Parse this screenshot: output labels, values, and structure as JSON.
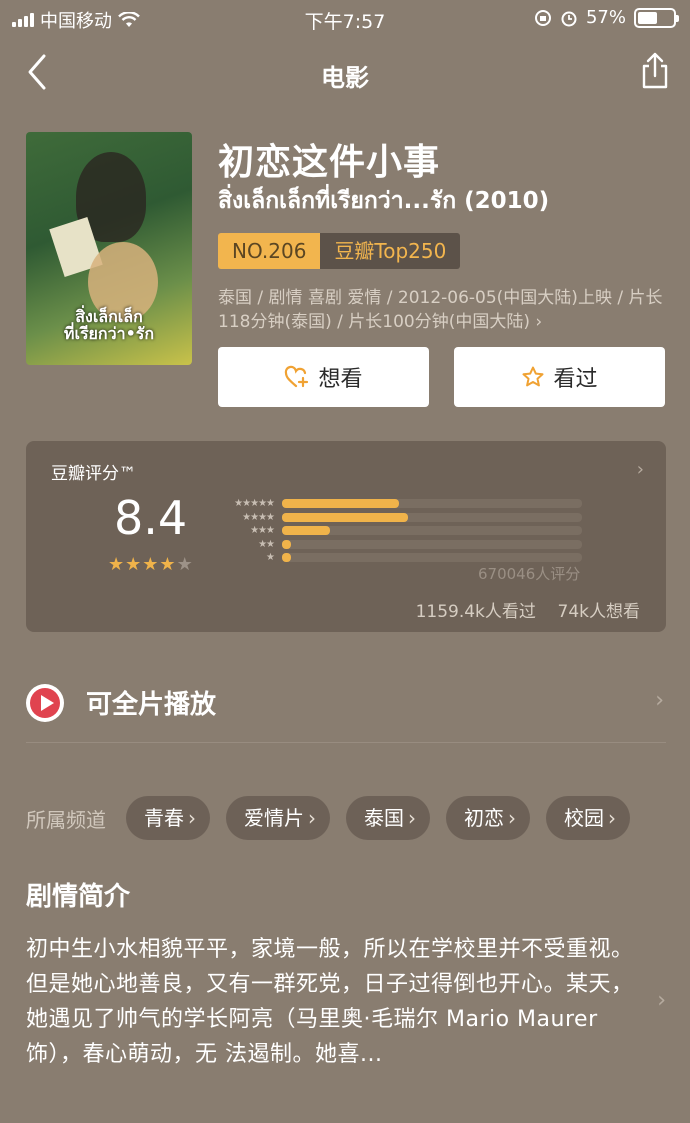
{
  "status_bar": {
    "carrier": "中国移动",
    "time": "下午7:57",
    "battery_percent": "57%",
    "battery_level": 0.57
  },
  "nav": {
    "title": "电影"
  },
  "movie": {
    "title_cn": "初恋这件小事",
    "title_original": "สิ่งเล็กเล็กที่เรียกว่า...รัก (2010)",
    "poster_text_line1": "สิ่งเล็กเล็ก",
    "poster_text_line2": "ที่เรียกว่า•รัก",
    "rank": "NO.206",
    "rank_list": "豆瓣Top250",
    "meta": "泰国 / 剧情 喜剧 爱情 / 2012-06-05(中国大陆)上映 / 片长118分钟(泰国) / 片长100分钟(中国大陆) ›"
  },
  "actions": {
    "want_label": "想看",
    "seen_label": "看过"
  },
  "rating": {
    "label": "豆瓣评分™",
    "score": "8.4",
    "stars": "★★★★★",
    "distribution": [
      0.39,
      0.42,
      0.16,
      0.03,
      0.03
    ],
    "rating_count": "670046人评分",
    "seen_count": "1159.4k人看过",
    "want_count": "74k人想看"
  },
  "play": {
    "label": "可全片播放"
  },
  "channels": {
    "label": "所属频道",
    "items": [
      "青春",
      "爱情片",
      "泰国",
      "初恋",
      "校园"
    ]
  },
  "synopsis": {
    "title": "剧情简介",
    "text": "初中生小水相貌平平，家境一般，所以在学校里并不受重视。但是她心地善良，又有一群死党，日子过得倒也开心。某天，她遇见了帅气的学长阿亮（马里奥·毛瑞尔 Mario Maurer 饰），春心萌动，无 法遏制。她喜..."
  }
}
